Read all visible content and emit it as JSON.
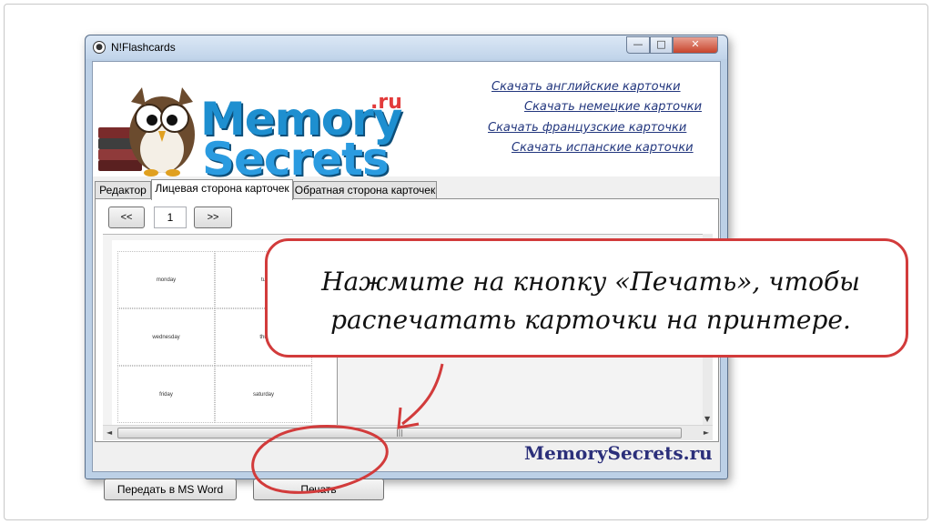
{
  "window": {
    "title": "N!Flashcards",
    "controls": {
      "minimize": "—",
      "maximize": "□",
      "close": "✕"
    }
  },
  "banner": {
    "logo_line1": "Memory",
    "logo_line2": "Secrets",
    "logo_suffix": ".ru",
    "download_links": [
      "Скачать английские карточки",
      "Скачать немецкие карточки",
      "Скачать французские карточки",
      "Скачать испанские карточки"
    ]
  },
  "tabs": [
    {
      "label": "Редактор"
    },
    {
      "label": "Лицевая сторона карточек",
      "active": true
    },
    {
      "label": "Обратная сторона карточек"
    }
  ],
  "pager": {
    "prev_label": "<<",
    "page": "1",
    "next_label": ">>"
  },
  "preview_cards": [
    "monday",
    "tu",
    "wednesday",
    "thu",
    "friday",
    "saturday"
  ],
  "buttons": {
    "export_word": "Передать в MS Word",
    "print": "Печать"
  },
  "brand_footer": "MemorySecrets.ru",
  "callout": {
    "line1": "Нажмите на кнопку «Печать», чтобы",
    "line2": "распечатать карточки на принтере."
  },
  "colors": {
    "annotation_red": "#d23b3b",
    "link_blue": "#23377e",
    "logo_blue": "#1e8fd0"
  }
}
